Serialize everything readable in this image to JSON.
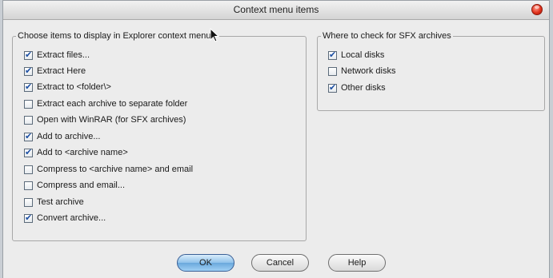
{
  "window": {
    "title": "Context menu items"
  },
  "left_group": {
    "legend": "Choose items to display in Explorer context menus",
    "items": [
      {
        "label": "Extract files...",
        "checked": true
      },
      {
        "label": "Extract Here",
        "checked": true
      },
      {
        "label": "Extract to <folder\\>",
        "checked": true
      },
      {
        "label": "Extract each archive to separate folder",
        "checked": false
      },
      {
        "label": "Open with WinRAR (for SFX archives)",
        "checked": false
      },
      {
        "label": "Add to archive...",
        "checked": true
      },
      {
        "label": "Add to <archive name>",
        "checked": true
      },
      {
        "label": "Compress to <archive name> and email",
        "checked": false
      },
      {
        "label": "Compress and email...",
        "checked": false
      },
      {
        "label": "Test archive",
        "checked": false
      },
      {
        "label": "Convert archive...",
        "checked": true
      }
    ]
  },
  "right_group": {
    "legend": "Where to check for SFX archives",
    "items": [
      {
        "label": "Local disks",
        "checked": true
      },
      {
        "label": "Network disks",
        "checked": false
      },
      {
        "label": "Other disks",
        "checked": true
      }
    ]
  },
  "buttons": {
    "ok": "OK",
    "cancel": "Cancel",
    "help": "Help"
  }
}
